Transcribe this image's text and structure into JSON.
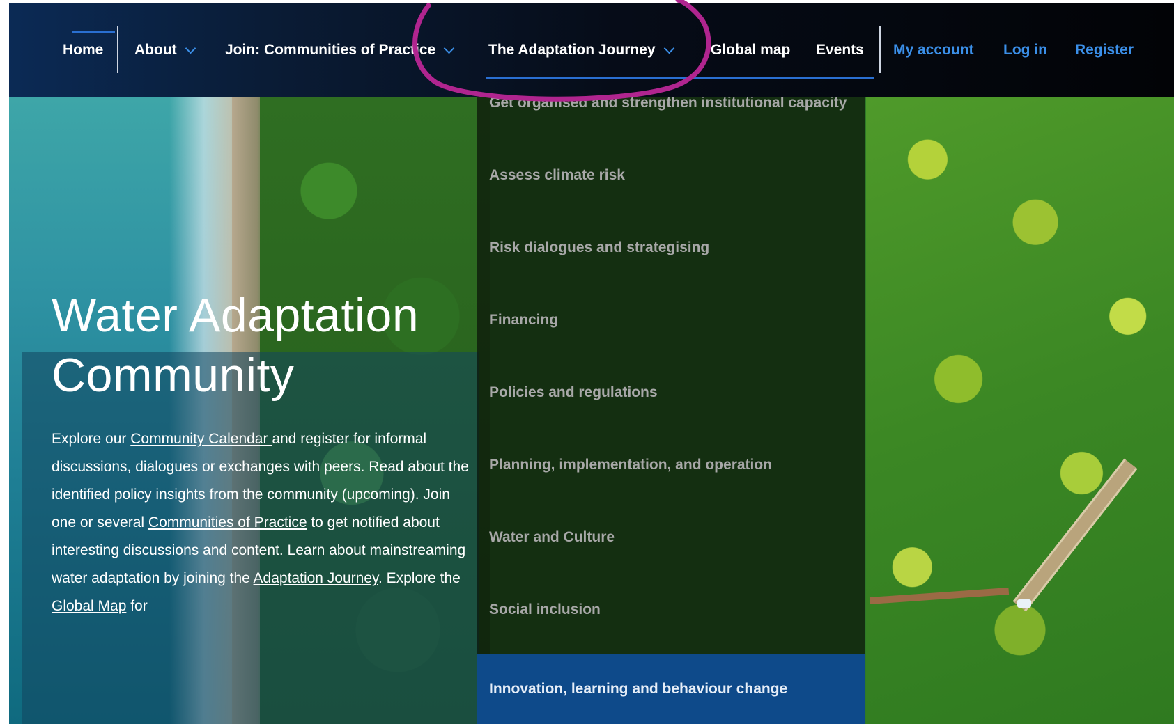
{
  "nav": {
    "items": [
      {
        "label": "Home"
      },
      {
        "label": "About"
      },
      {
        "label": "Join: Communities of Practice"
      },
      {
        "label": "The Adaptation Journey"
      },
      {
        "label": "Global map"
      },
      {
        "label": "Events"
      }
    ],
    "account": [
      {
        "label": "My account"
      },
      {
        "label": "Log in"
      },
      {
        "label": "Register"
      }
    ],
    "active": "The Adaptation Journey"
  },
  "dropdown": {
    "items": [
      {
        "label": "Get organised and strengthen institutional capacity"
      },
      {
        "label": "Assess climate risk"
      },
      {
        "label": "Risk dialogues and strategising"
      },
      {
        "label": "Financing"
      },
      {
        "label": "Policies and regulations"
      },
      {
        "label": "Planning, implementation, and operation"
      },
      {
        "label": "Water and Culture"
      },
      {
        "label": "Social inclusion"
      },
      {
        "label": "Innovation, learning and behaviour change"
      }
    ],
    "highlighted": "Innovation, learning and behaviour change"
  },
  "hero": {
    "title_line1": "Water Adaptation",
    "title_line2": "Community",
    "text": {
      "p1": "Explore our ",
      "link1": "Community Calendar ",
      "p2": "and register for informal discussions, dialogues or exchanges with peers. Read about the identified policy insights from the community (upcoming). Join one or several ",
      "link2": "Communities of Practice",
      "p3": " to get notified about interesting discussions and content. Learn about mainstreaming water adaptation by joining the ",
      "link3": "Adaptation Journey",
      "p4": ". Explore the ",
      "link4": "Global Map",
      "p5": " for"
    }
  },
  "colors": {
    "link_blue": "#3b8fe8",
    "active_underline": "#2a6fd1",
    "highlight_bg": "#0e4a8a",
    "annotation": "#b0258f"
  }
}
